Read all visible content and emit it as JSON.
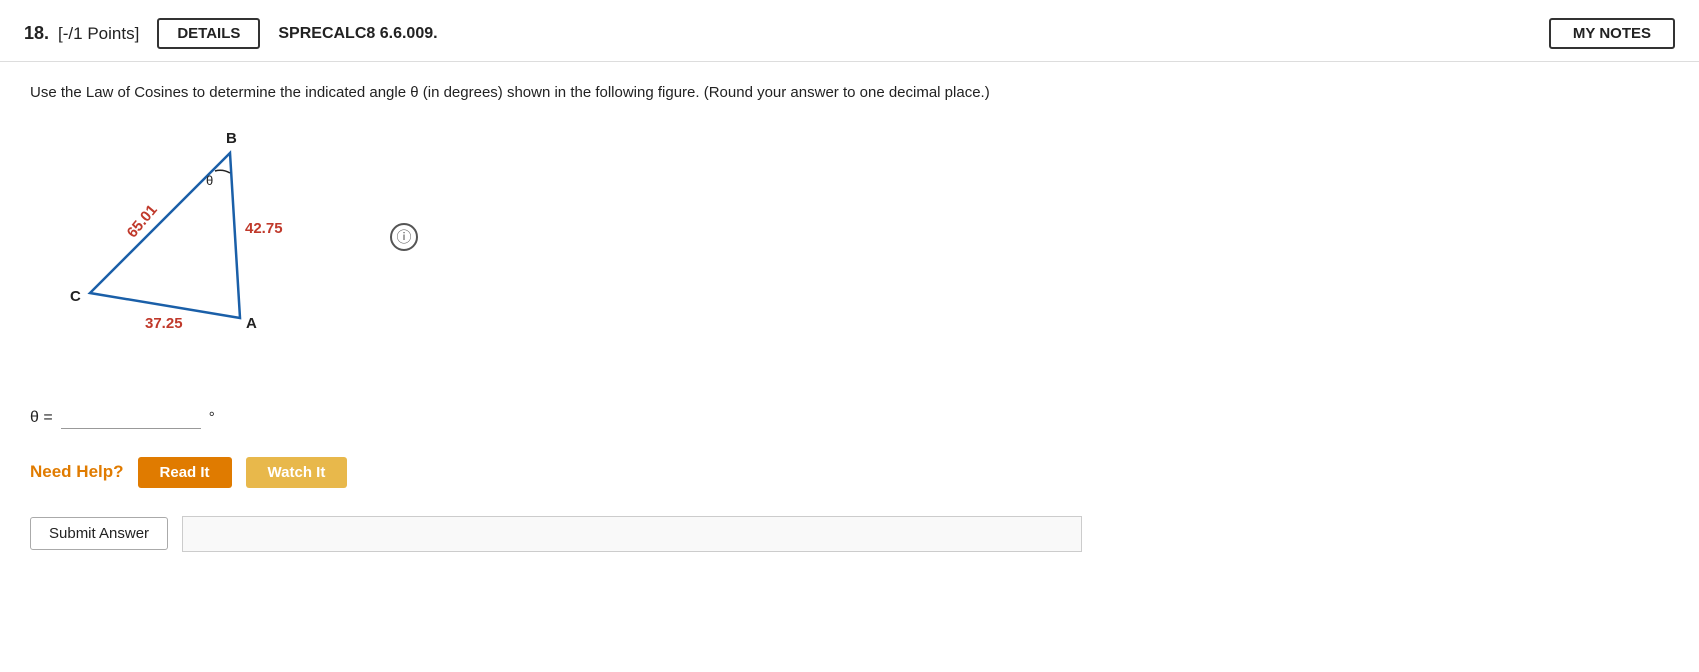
{
  "header": {
    "question_number": "18.",
    "points_label": "[-/1 Points]",
    "details_button": "DETAILS",
    "problem_id": "SPRECALC8 6.6.009.",
    "my_notes_button": "MY NOTES"
  },
  "problem": {
    "description": "Use the Law of Cosines to determine the indicated angle θ (in degrees) shown in the following figure. (Round your answer to one decimal place.)",
    "triangle": {
      "side_cb": "65.01",
      "side_ba": "42.75",
      "side_ca": "37.25",
      "vertex_b": "B",
      "vertex_c": "C",
      "vertex_a": "A",
      "angle_label": "θ"
    },
    "answer_label": "θ =",
    "answer_placeholder": "",
    "degree_symbol": "°",
    "info_icon": "ⓘ"
  },
  "help": {
    "need_help_label": "Need Help?",
    "read_it_button": "Read It",
    "watch_it_button": "Watch It"
  },
  "footer": {
    "submit_button": "Submit Answer"
  }
}
